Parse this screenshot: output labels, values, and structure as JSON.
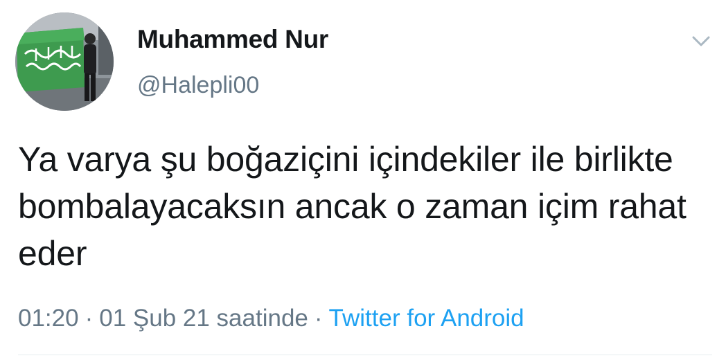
{
  "author": {
    "display_name": "Muhammed Nur",
    "handle": "@Halepli00"
  },
  "tweet": {
    "text": "Ya varya şu boğaziçini içindekiler ile birlikte bombalayacaksın ancak o zaman içim rahat eder",
    "time": "01:20",
    "date": "01 Şub 21 saatinde",
    "separator": "·",
    "source": "Twitter for Android"
  },
  "icons": {
    "menu": "chevron-down-icon",
    "avatar": "profile-photo"
  },
  "colors": {
    "text": "#14171a",
    "secondary": "#657786",
    "link": "#1da1f2",
    "caret": "#aab8c2"
  }
}
